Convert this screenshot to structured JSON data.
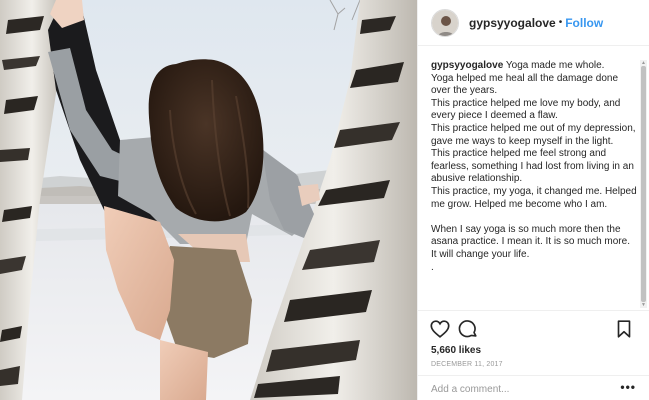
{
  "post": {
    "image_alt_icon": "yoga-photo",
    "header": {
      "username": "gypsyyogalove",
      "separator": "•",
      "follow_label": "Follow"
    },
    "caption": {
      "username": "gypsyyogalove",
      "lines": [
        "Yoga made me whole.",
        "Yoga helped me heal all the damage done over the years.",
        "This practice helped me love my body, and every piece I deemed a flaw.",
        "This practice helped me out of my depression, gave me ways to keep myself in the light.",
        "This practice helped me feel strong and fearless, something I had lost from living in an abusive relationship.",
        "This practice, my yoga, it changed me. Helped me grow. Helped me become who I am.",
        "",
        "When I say yoga is so much more then the asana practice. I mean it. It is so much more.",
        "It will change your life.",
        "."
      ]
    },
    "likes": "5,660 likes",
    "date": "DECEMBER 11, 2017",
    "comment": {
      "placeholder": "Add a comment...",
      "more_label": "•••"
    },
    "icons": {
      "like": "heart-icon",
      "comment": "comment-icon",
      "save": "bookmark-icon"
    },
    "colors": {
      "accent": "#3897f0",
      "text": "#262626",
      "muted": "#999999",
      "border": "#efefef"
    }
  }
}
